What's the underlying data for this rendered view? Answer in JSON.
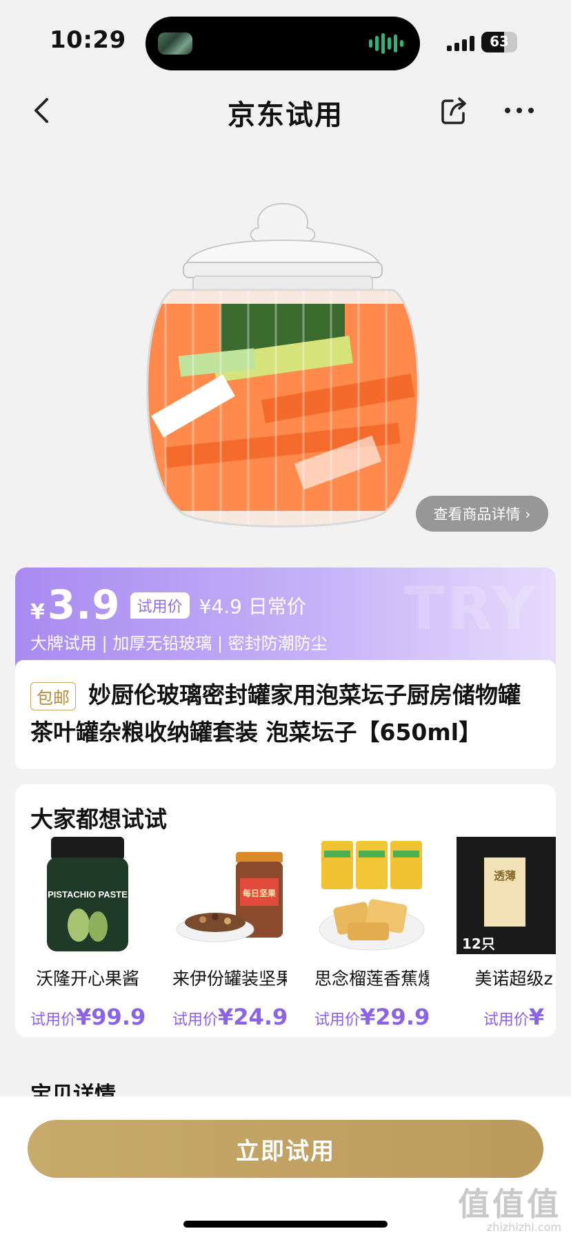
{
  "status": {
    "time": "10:29",
    "battery": "63",
    "battery_level": 0.63
  },
  "nav": {
    "title": "京东试用"
  },
  "hero": {
    "detail_button": "查看商品详情 ›"
  },
  "price": {
    "currency": "¥",
    "value": "3.9",
    "trial_tag": "试用价",
    "daily_price": "¥4.9 日常价",
    "watermark": "TRY",
    "features": "大牌试用 | 加厚无铅玻璃 | 密封防潮防尘"
  },
  "product": {
    "tag": "包邮",
    "title": "妙厨伦玻璃密封罐家用泡菜坛子厨房储物罐茶叶罐杂粮收纳罐套装 泡菜坛子【650ml】"
  },
  "recommend": {
    "title": "大家都想试试",
    "items": [
      {
        "name": "沃隆开心果酱",
        "price_label": "试用价",
        "price": "¥99.9",
        "img_text": "PISTACHIO PASTE"
      },
      {
        "name": "来伊份罐装坚果",
        "price_label": "试用价",
        "price": "¥24.9",
        "img_text": "每日坚果"
      },
      {
        "name": "思念榴莲香蕉爆",
        "price_label": "试用价",
        "price": "¥29.9",
        "img_text": ""
      },
      {
        "name": "美诺超级z",
        "price_label": "试用价",
        "price": "¥",
        "img_text": "透薄",
        "img_badge": "12只"
      }
    ]
  },
  "next_section": {
    "title": "宝贝详情"
  },
  "cta": {
    "label": "立即试用"
  },
  "watermark": {
    "big": "值值值",
    "small": "zhizhizhi.com"
  },
  "colors": {
    "accent_purple": "#a98af0",
    "gold": "#c8aa6b"
  }
}
